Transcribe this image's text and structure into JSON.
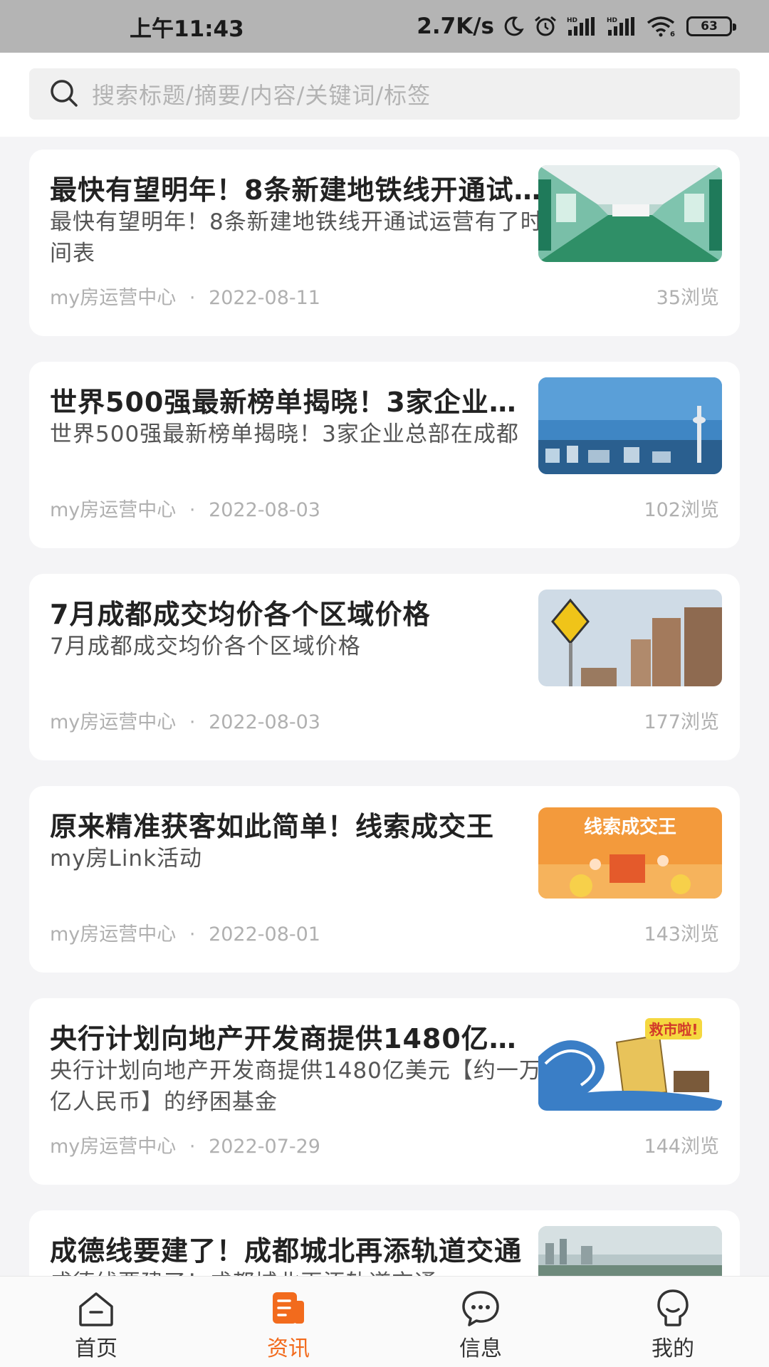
{
  "status_bar": {
    "time": "上午11:43",
    "speed": "2.7K/s",
    "battery": "63"
  },
  "search": {
    "placeholder": "搜索标题/摘要/内容/关键词/标签"
  },
  "articles": [
    {
      "title": "最快有望明年！8条新建地铁线开通试运营有了时间表",
      "summary": "最快有望明年！8条新建地铁线开通试运营有了时间表",
      "author": "my房运营中心",
      "date": "2022-08-11",
      "views": "35浏览"
    },
    {
      "title": "世界500强最新榜单揭晓！3家企业总部在成都",
      "summary": "世界500强最新榜单揭晓！3家企业总部在成都",
      "author": "my房运营中心",
      "date": "2022-08-03",
      "views": "102浏览"
    },
    {
      "title": "7月成都成交均价各个区域价格",
      "summary": "7月成都成交均价各个区域价格",
      "author": "my房运营中心",
      "date": "2022-08-03",
      "views": "177浏览"
    },
    {
      "title": "原来精准获客如此简单！线索成交王",
      "summary": "my房Link活动",
      "author": "my房运营中心",
      "date": "2022-08-01",
      "views": "143浏览",
      "thumb_text": "线索成交王"
    },
    {
      "title": "央行计划向地产开发商提供1480亿美元【约一万亿人民币】的纾困基金",
      "summary": "央行计划向地产开发商提供1480亿美元【约一万亿人民币】的纾困基金",
      "author": "my房运营中心",
      "date": "2022-07-29",
      "views": "144浏览",
      "thumb_text": "救市啦!"
    },
    {
      "title": "成德线要建了！成都城北再添轨道交通",
      "summary": "成德线要建了！成都城北再添轨道交通",
      "author": "my房运营中心",
      "date": "",
      "views": ""
    }
  ],
  "meta_separator": "·",
  "nav": [
    {
      "label": "首页",
      "icon": "home-icon"
    },
    {
      "label": "资讯",
      "icon": "news-icon"
    },
    {
      "label": "信息",
      "icon": "message-icon"
    },
    {
      "label": "我的",
      "icon": "profile-icon"
    }
  ],
  "colors": {
    "accent": "#f26b1d",
    "background": "#f4f4f6",
    "status_bar": "#b4b4b4"
  }
}
